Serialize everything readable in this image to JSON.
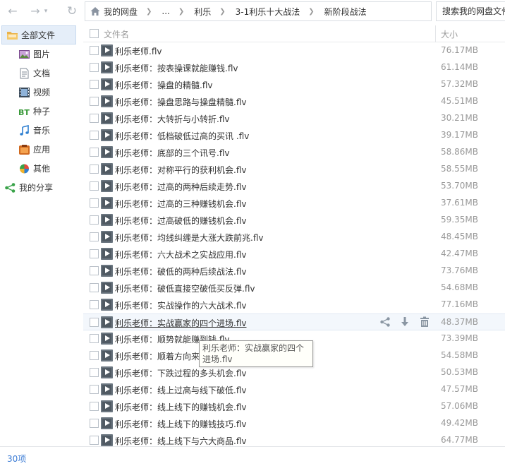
{
  "toolbar": {
    "breadcrumb": [
      "我的网盘",
      "...",
      "利乐",
      "3-1利乐十大战法",
      "新阶段战法"
    ],
    "search_placeholder": "搜索我的网盘文件"
  },
  "sidebar": {
    "items": [
      {
        "label": "全部文件",
        "icon": "folder-icon"
      },
      {
        "label": "图片",
        "icon": "image-icon"
      },
      {
        "label": "文档",
        "icon": "document-icon"
      },
      {
        "label": "视频",
        "icon": "video-icon"
      },
      {
        "label": "种子",
        "icon": "bt-icon"
      },
      {
        "label": "音乐",
        "icon": "music-icon"
      },
      {
        "label": "应用",
        "icon": "app-icon"
      },
      {
        "label": "其他",
        "icon": "pie-icon"
      },
      {
        "label": "我的分享",
        "icon": "share-icon"
      }
    ]
  },
  "list": {
    "header_name": "文件名",
    "header_size": "大小",
    "rows": [
      {
        "name": "利乐老师.flv",
        "size": "76.17MB"
      },
      {
        "name": "利乐老师：按表操课就能赚钱.flv",
        "size": "61.14MB"
      },
      {
        "name": "利乐老师：操盘的精髓.flv",
        "size": "57.32MB"
      },
      {
        "name": "利乐老师：操盘思路与操盘精髓.flv",
        "size": "45.51MB"
      },
      {
        "name": "利乐老师：大转折与小转折.flv",
        "size": "30.21MB"
      },
      {
        "name": "利乐老师：低档破低过高的买讯 .flv",
        "size": "39.17MB"
      },
      {
        "name": "利乐老师：底部的三个讯号.flv",
        "size": "58.86MB"
      },
      {
        "name": "利乐老师：对称平行的获利机会.flv",
        "size": "58.55MB"
      },
      {
        "name": "利乐老师：过高的两种后续走势.flv",
        "size": "53.70MB"
      },
      {
        "name": "利乐老师：过高的三种赚钱机会.flv",
        "size": "37.61MB"
      },
      {
        "name": "利乐老师：过高破低的赚钱机会.flv",
        "size": "59.35MB"
      },
      {
        "name": "利乐老师：均线纠缠是大涨大跌前兆.flv",
        "size": "48.45MB"
      },
      {
        "name": "利乐老师：六大战术之实战应用.flv",
        "size": "42.47MB"
      },
      {
        "name": "利乐老师：破低的两种后续战法.flv",
        "size": "73.76MB"
      },
      {
        "name": "利乐老师：破低直接空破低买反弹.flv",
        "size": "54.68MB"
      },
      {
        "name": "利乐老师：实战操作的六大战术.flv",
        "size": "77.16MB"
      },
      {
        "name": "利乐老师：实战赢家的四个进场.flv",
        "size": "48.37MB"
      },
      {
        "name": "利乐老师：顺势就能赚到钱.flv",
        "size": "73.39MB"
      },
      {
        "name": "利乐老师：顺着方向来",
        "size": "54.58MB"
      },
      {
        "name": "利乐老师：下跌过程的多头机会.flv",
        "size": "50.53MB"
      },
      {
        "name": "利乐老师：线上过高与线下破低.flv",
        "size": "47.57MB"
      },
      {
        "name": "利乐老师：线上线下的赚钱机会.flv",
        "size": "57.06MB"
      },
      {
        "name": "利乐老师：线上线下的赚钱技巧.flv",
        "size": "49.42MB"
      },
      {
        "name": "利乐老师：线上线下与六大商品.flv",
        "size": "64.77MB"
      }
    ]
  },
  "tooltip": "利乐老师：实战赢家的四个进场.flv",
  "status": {
    "count": "30项"
  }
}
